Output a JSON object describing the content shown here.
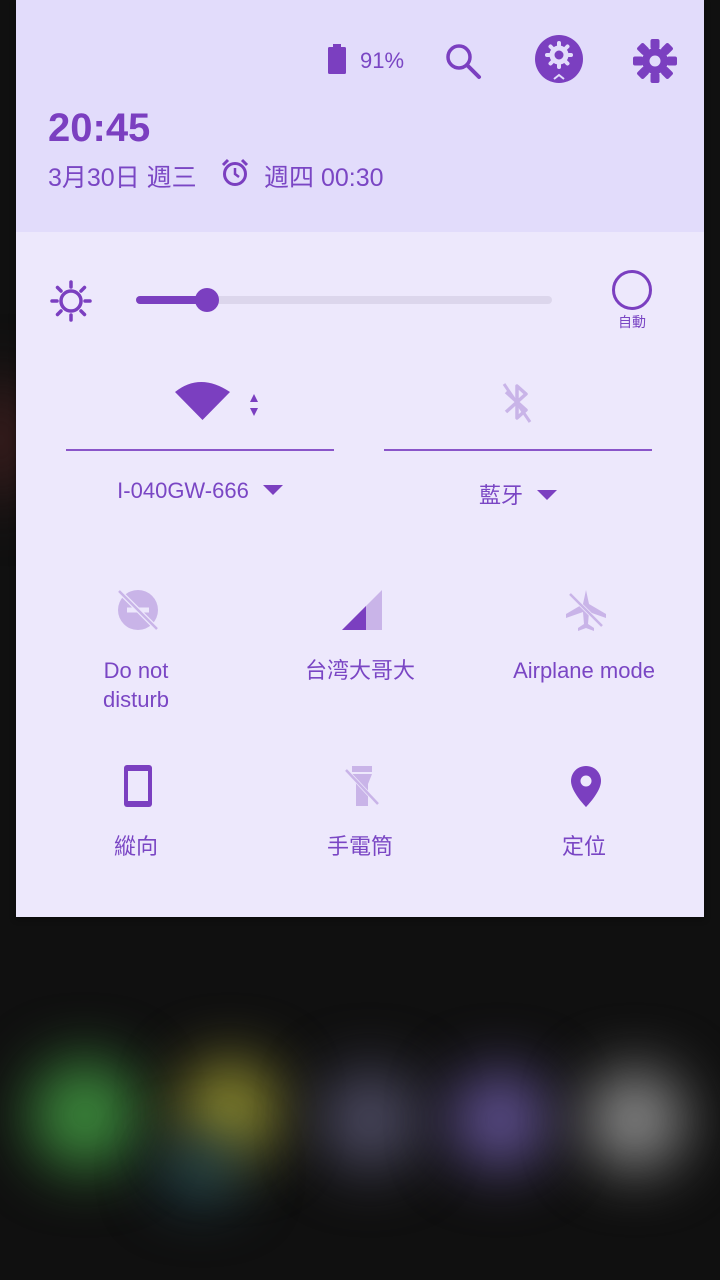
{
  "status": {
    "battery_percent": "91%",
    "time": "20:45",
    "date": "3月30日 週三",
    "next_alarm": "週四 00:30"
  },
  "brightness": {
    "level": 0.17,
    "auto_label": "自動"
  },
  "connections": {
    "wifi_label": "I-040GW-666",
    "bluetooth_label": "藍牙"
  },
  "tiles": [
    {
      "label": "Do not\ndisturb",
      "icon": "do-not-disturb-icon",
      "active": false
    },
    {
      "label": "台湾大哥大",
      "icon": "cellular-signal-icon",
      "active": true
    },
    {
      "label": "Airplane mode",
      "icon": "airplane-icon",
      "active": false
    },
    {
      "label": "縱向",
      "icon": "portrait-rotation-icon",
      "active": true
    },
    {
      "label": "手電筒",
      "icon": "flashlight-off-icon",
      "active": false
    },
    {
      "label": "定位",
      "icon": "location-icon",
      "active": true
    }
  ],
  "colors": {
    "accent": "#7b3fc0",
    "inactive": "#c9b4e8",
    "header_bg": "#e2dcfb",
    "panel_bg": "#ede8fc"
  }
}
